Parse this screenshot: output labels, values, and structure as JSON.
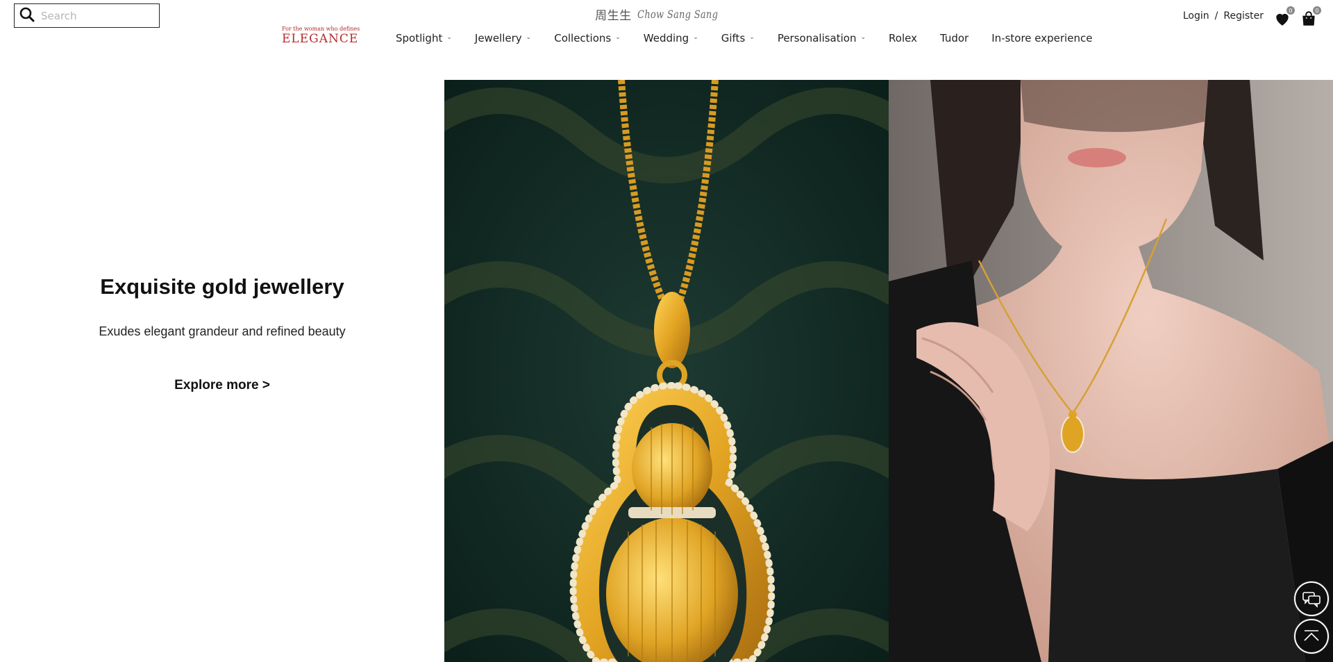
{
  "search": {
    "placeholder": "Search"
  },
  "brand": {
    "chinese": "周生生",
    "english": "Chow Sang Sang"
  },
  "tagline": {
    "small": "For the woman who defines",
    "big": "ELEGANCE"
  },
  "nav": [
    {
      "label": "Spotlight",
      "has_dropdown": true
    },
    {
      "label": "Jewellery",
      "has_dropdown": true
    },
    {
      "label": "Collections",
      "has_dropdown": true
    },
    {
      "label": "Wedding",
      "has_dropdown": true
    },
    {
      "label": "Gifts",
      "has_dropdown": true
    },
    {
      "label": "Personalisation",
      "has_dropdown": true
    },
    {
      "label": "Rolex",
      "has_dropdown": false
    },
    {
      "label": "Tudor",
      "has_dropdown": false
    },
    {
      "label": "In-store experience",
      "has_dropdown": false
    }
  ],
  "account": {
    "login": "Login",
    "separator": "/",
    "register": "Register"
  },
  "wishlist": {
    "count": "0",
    "icon": "heart-icon"
  },
  "cart": {
    "count": "0",
    "icon": "shopping-bag-icon"
  },
  "hero": {
    "title": "Exquisite gold jewellery",
    "subtitle": "Exudes elegant grandeur and refined beauty",
    "cta": "Explore more >"
  },
  "floating": {
    "chat_icon": "chat-icon",
    "top_icon": "back-to-top-icon"
  },
  "colors": {
    "accent_red": "#b52a2a",
    "gold": "#e0a92a",
    "dark_green": "#0f2a24"
  }
}
